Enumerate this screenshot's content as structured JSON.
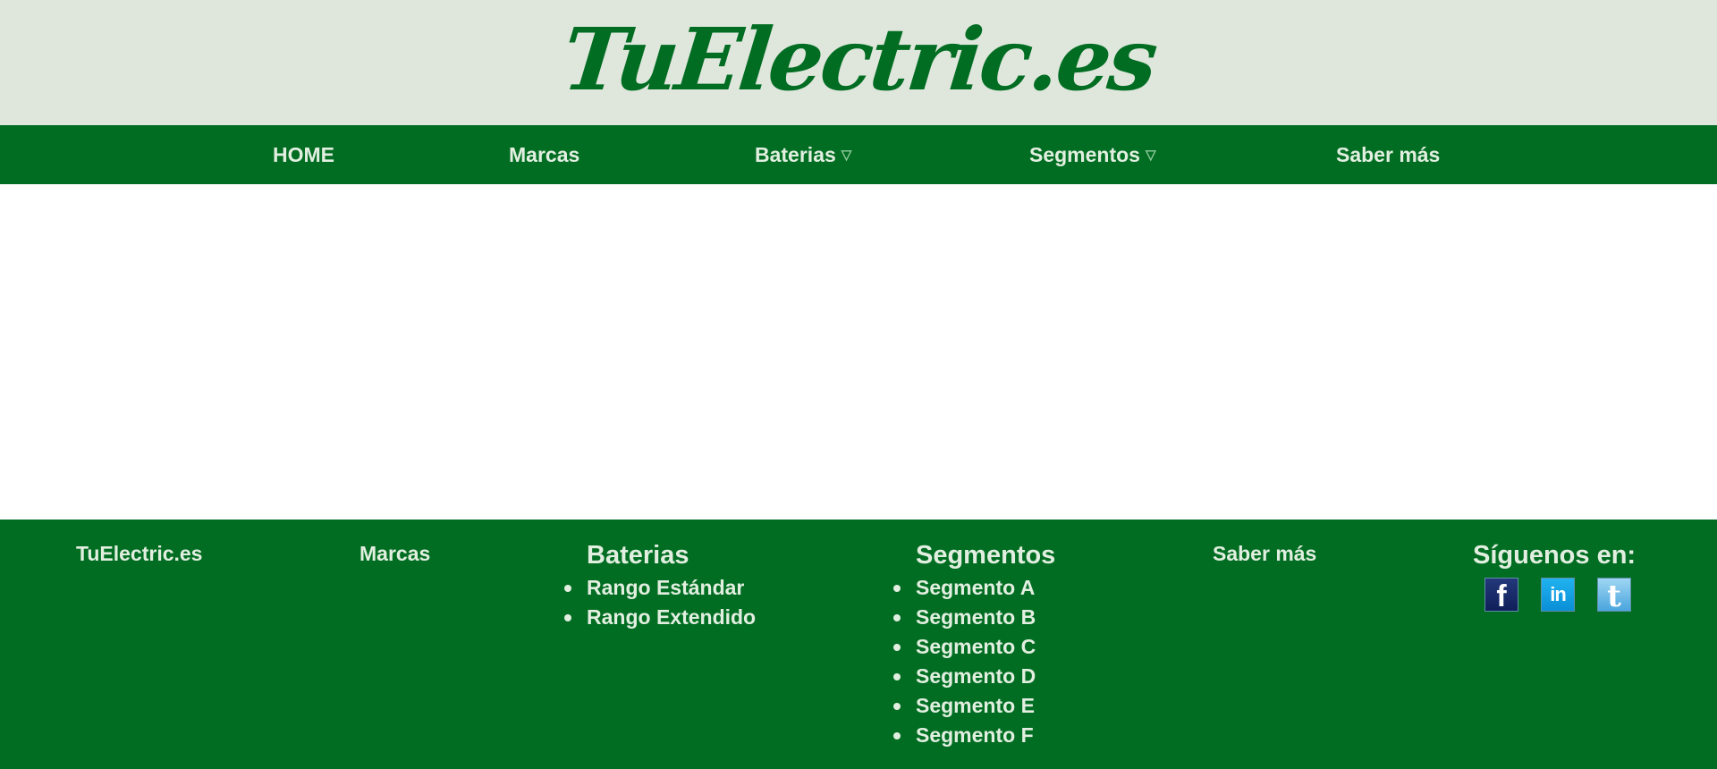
{
  "header": {
    "logo_text": "TuElectric.es"
  },
  "nav": {
    "items": [
      {
        "label": "HOME",
        "has_dropdown": false
      },
      {
        "label": "Marcas",
        "has_dropdown": false
      },
      {
        "label": "Baterias",
        "has_dropdown": true
      },
      {
        "label": "Segmentos",
        "has_dropdown": true
      },
      {
        "label": "Saber más",
        "has_dropdown": false
      }
    ],
    "caret": "▽"
  },
  "footer": {
    "brand": "TuElectric.es",
    "marcas": "Marcas",
    "baterias": {
      "title": "Baterias",
      "items": [
        "Rango Estándar",
        "Rango Extendido"
      ]
    },
    "segmentos": {
      "title": "Segmentos",
      "items": [
        "Segmento A",
        "Segmento B",
        "Segmento C",
        "Segmento D",
        "Segmento E",
        "Segmento F"
      ]
    },
    "saber_mas": "Saber más",
    "social": {
      "title": "Síguenos en:",
      "icons": [
        {
          "name": "facebook-icon",
          "glyph": "f",
          "color": "#1a2d6b"
        },
        {
          "name": "linkedin-icon",
          "glyph": "in",
          "color": "#14a3e6"
        },
        {
          "name": "twitter-icon",
          "glyph": "t",
          "color": "#6fbde8"
        }
      ]
    }
  },
  "colors": {
    "brand_green": "#016d22",
    "header_bg": "#dfe7dc",
    "nav_text": "#e2efe0"
  }
}
